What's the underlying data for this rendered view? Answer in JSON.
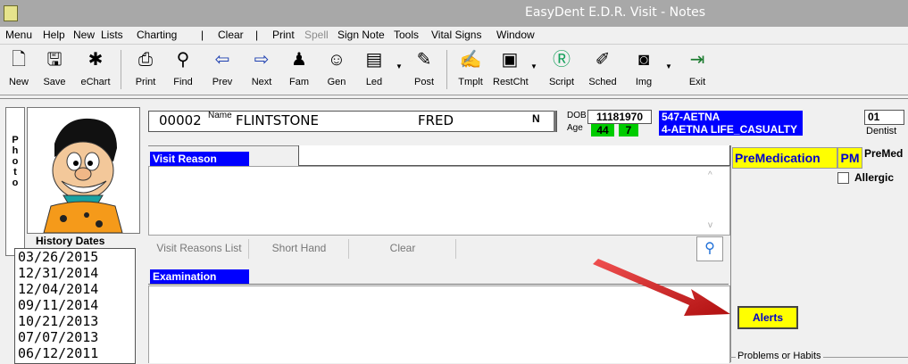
{
  "window": {
    "title": "EasyDent E.D.R. Visit - Notes"
  },
  "menu": [
    "Menu",
    "Help",
    "New",
    "Lists",
    "Charting",
    "|",
    "Clear",
    "|",
    "Print",
    "Spell",
    "Sign Note",
    "Tools",
    "Vital Signs",
    "Window"
  ],
  "toolbar": {
    "new": "New",
    "save": "Save",
    "echart": "eChart",
    "print": "Print",
    "find": "Find",
    "prev": "Prev",
    "next": "Next",
    "fam": "Fam",
    "gen": "Gen",
    "led": "Led",
    "post": "Post",
    "tmplt": "Tmplt",
    "restcht": "RestCht",
    "script": "Script",
    "sched": "Sched",
    "img": "Img",
    "exit": "Exit"
  },
  "patient": {
    "id": "00002",
    "name_label": "Name",
    "last": "FLINTSTONE",
    "first": "FRED",
    "mi": "N",
    "dob_label": "DOB",
    "dob": "11181970",
    "age_label": "Age",
    "age_years": "44",
    "age_months": "7",
    "ins1": "547-AETNA",
    "ins2": "4-AETNA LIFE_CASUALTY",
    "dentist_no": "01",
    "dentist_label": "Dentist"
  },
  "photo_tab": "Photo",
  "history": {
    "title": "History Dates",
    "dates": [
      "03/26/2015",
      "12/31/2014",
      "12/04/2014",
      "09/11/2014",
      "10/21/2013",
      "07/07/2013",
      "06/12/2011"
    ]
  },
  "visit": {
    "title": "Visit Reason",
    "list_btn": "Visit Reasons List",
    "shorthand_btn": "Short Hand",
    "clear_btn": "Clear"
  },
  "exam": {
    "title": "Examination"
  },
  "premed": {
    "title": "PreMedication",
    "pm": "PM",
    "premed": "PreMed",
    "allergic": "Allergic"
  },
  "alerts": "Alerts",
  "problems": "Problems or Habits",
  "colors": {
    "accent": "#0000ff",
    "yellow": "#ffff00",
    "green": "#00cc00",
    "arrow": "#e32222"
  }
}
